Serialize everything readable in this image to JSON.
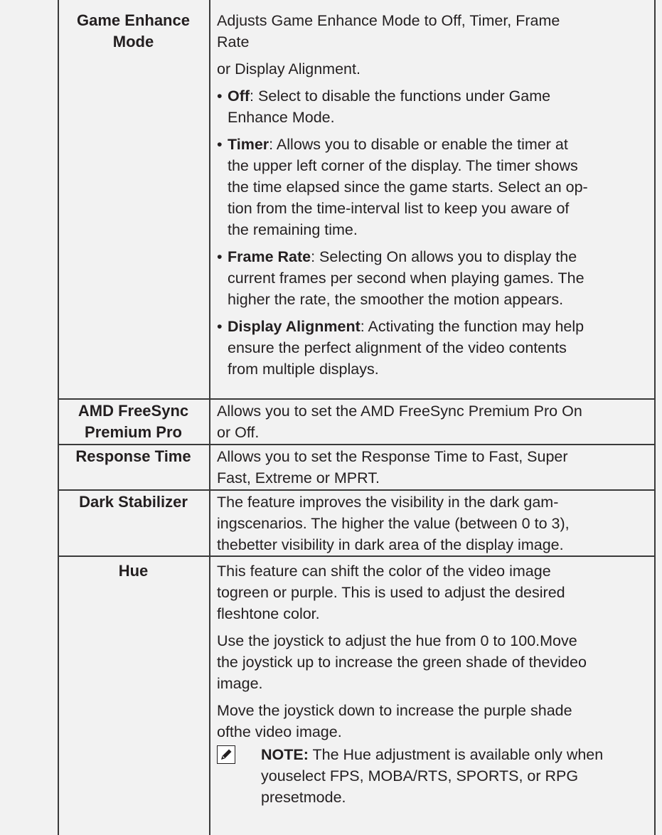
{
  "rows": [
    {
      "label_lines": [
        "Game Enhance",
        "Mode"
      ],
      "intro_lines": [
        "Adjusts Game Enhance Mode to Off, Timer, Frame",
        "Rate"
      ],
      "intro2": "or Display Alignment.",
      "bullets": [
        {
          "term": "Off",
          "lines": [
            ": Select to disable the functions under Game",
            "Enhance Mode."
          ]
        },
        {
          "term": "Timer",
          "lines": [
            ": Allows you to disable or enable the timer at",
            "the upper left corner of the display. The timer shows",
            "the time elapsed since the game starts. Select an op-",
            "tion from the time-interval list to keep you aware of",
            "the remaining time."
          ]
        },
        {
          "term": "Frame Rate",
          "lines": [
            ": Selecting On allows you to display the",
            "current frames per second when playing games. The",
            "higher the rate, the smoother the motion appears."
          ]
        },
        {
          "term": "Display Alignment",
          "lines": [
            ": Activating the function may help",
            "ensure the perfect alignment of the video contents",
            "from multiple displays."
          ]
        }
      ]
    },
    {
      "label_lines": [
        "AMD FreeSync",
        "Premium Pro"
      ],
      "desc_lines": [
        "Allows you to set the AMD FreeSync Premium Pro On",
        "or Off."
      ]
    },
    {
      "label_lines": [
        "Response Time"
      ],
      "desc_lines": [
        "Allows you to set the Response Time to Fast, Super",
        "Fast, Extreme or MPRT."
      ]
    },
    {
      "label_lines": [
        "Dark Stabilizer"
      ],
      "desc_lines": [
        "The feature improves the visibility in the dark gam-",
        "ingscenarios. The higher the value (between 0 to 3),",
        "thebetter visibility in dark area of the display image."
      ]
    },
    {
      "label_lines": [
        "Hue"
      ],
      "p1_lines": [
        "This feature can shift the color of the video image",
        "togreen or purple. This is used to adjust the desired",
        "fleshtone color."
      ],
      "p2_lines": [
        "Use the joystick to adjust the hue from 0 to 100.Move",
        "the joystick up to increase the green shade of thevideo",
        "image."
      ],
      "p3_lines": [
        "Move the joystick down to increase the purple shade",
        "ofthe video image."
      ],
      "note": {
        "label": "NOTE:",
        "line1": "The Hue adjustment is available only when",
        "line2_a": "youselect ",
        "kw1": "FPS",
        "sep1": ", ",
        "kw2": "MOBA/RTS",
        "sep2": ", ",
        "kw3": "SPORTS",
        "sep3": ", or ",
        "kw4": "RPG",
        "line3": "presetmode."
      }
    }
  ]
}
